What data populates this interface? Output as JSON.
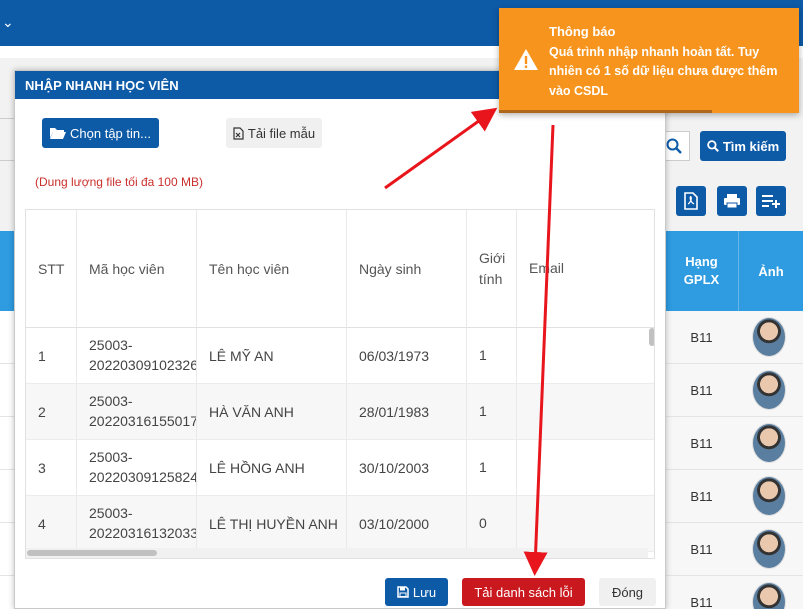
{
  "background": {
    "search_button": "Tìm kiếm",
    "table_headers": {
      "hang": "Hạng\nGPLX",
      "anh": "Ảnh"
    },
    "rows": [
      {
        "hang": "B11"
      },
      {
        "hang": "B11"
      },
      {
        "hang": "B11"
      },
      {
        "hang": "B11"
      },
      {
        "hang": "B11"
      },
      {
        "hang": "B11"
      }
    ]
  },
  "modal": {
    "title": "NHẬP NHANH HỌC VIÊN",
    "choose_file_button": "Chọn tập tin...",
    "template_button": "Tải file mẫu",
    "size_note": "(Dung lượng file tối đa 100 MB)",
    "columns": {
      "stt": "STT",
      "ma": "Mã học viên",
      "ten": "Tên học viên",
      "ngay": "Ngày sinh",
      "gioi_tinh": "Giới tính",
      "email": "Email"
    },
    "rows": [
      {
        "stt": "1",
        "ma": "25003-\n20220309102326",
        "ten": "LÊ MỸ AN",
        "ngay": "06/03/1973",
        "gt": "1"
      },
      {
        "stt": "2",
        "ma": "25003-\n20220316155017",
        "ten": "HÀ VĂN ANH",
        "ngay": "28/01/1983",
        "gt": "1"
      },
      {
        "stt": "3",
        "ma": "25003-\n20220309125824",
        "ten": "LÊ HỒNG ANH",
        "ngay": "30/10/2003",
        "gt": "1"
      },
      {
        "stt": "4",
        "ma": "25003-\n20220316132033",
        "ten": "LÊ THỊ HUYỀN ANH",
        "ngay": "03/10/2000",
        "gt": "0"
      }
    ],
    "save_button": "Lưu",
    "download_errors_button": "Tải danh sách lỗi",
    "close_button": "Đóng"
  },
  "toast": {
    "title": "Thông báo",
    "message": "Quá trình nhập nhanh hoàn tất. Tuy nhiên có 1 số dữ liệu chưa được thêm vào CSDL",
    "progress": 0.71
  },
  "colors": {
    "primary": "#0d5aa7",
    "danger": "#c9181e",
    "warning": "#f7941d",
    "table_header": "#2f9be0",
    "note": "#c9302c"
  }
}
